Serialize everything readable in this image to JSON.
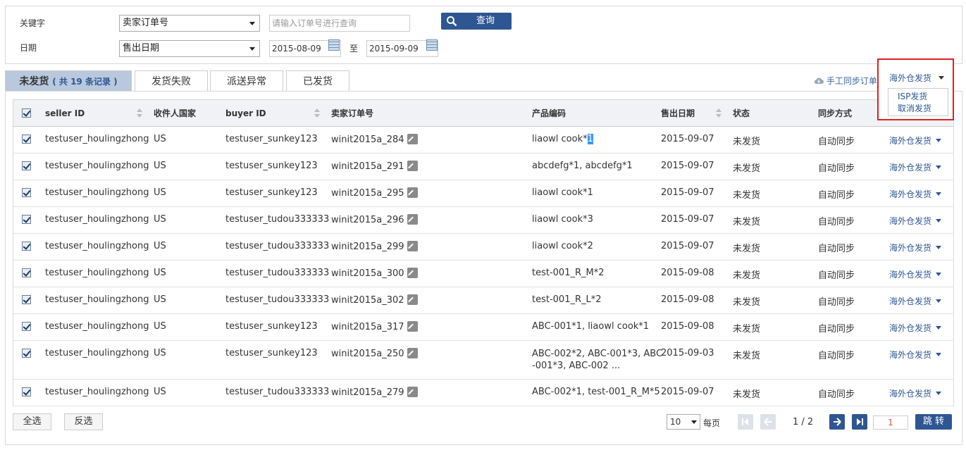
{
  "search": {
    "keyword_label": "关键字",
    "keyword_select": "卖家订单号",
    "keyword_placeholder": "请输入订单号进行查询",
    "date_label": "日期",
    "date_select": "售出日期",
    "date_from": "2015-08-09",
    "date_to_label": "至",
    "date_to": "2015-09-09",
    "search_button": "查询"
  },
  "tabs": [
    {
      "label": "未发货",
      "count": "( 共 19 条记录 )",
      "active": true
    },
    {
      "label": "发货失败"
    },
    {
      "label": "派送异常"
    },
    {
      "label": "已发货"
    }
  ],
  "toolbar": {
    "sync_label": "手工同步订单",
    "ship_dropdown": "海外仓发货",
    "ship_menu": [
      "ISP发货",
      "取消发货"
    ]
  },
  "table": {
    "headers": [
      "seller ID",
      "收件人国家",
      "buyer ID",
      "卖家订单号",
      "产品编码",
      "售出日期",
      "状态",
      "同步方式"
    ],
    "rows": [
      {
        "seller": "testuser_houlingzhong",
        "country": "US",
        "buyer": "testuser_sunkey123",
        "order": "winit2015a_284",
        "product": "liaowl cook*",
        "product_sel": "1",
        "date": "2015-09-07",
        "status": "未发货",
        "sync": "自动同步",
        "action": "海外仓发货"
      },
      {
        "seller": "testuser_houlingzhong",
        "country": "US",
        "buyer": "testuser_sunkey123",
        "order": "winit2015a_291",
        "product": "abcdefg*1, abcdefg*1",
        "date": "2015-09-07",
        "status": "未发货",
        "sync": "自动同步",
        "action": "海外仓发货"
      },
      {
        "seller": "testuser_houlingzhong",
        "country": "US",
        "buyer": "testuser_sunkey123",
        "order": "winit2015a_295",
        "product": "liaowl cook*1",
        "date": "2015-09-07",
        "status": "未发货",
        "sync": "自动同步",
        "action": "海外仓发货"
      },
      {
        "seller": "testuser_houlingzhong",
        "country": "US",
        "buyer": "testuser_tudou333333",
        "order": "winit2015a_296",
        "product": "liaowl cook*3",
        "date": "2015-09-07",
        "status": "未发货",
        "sync": "自动同步",
        "action": "海外仓发货"
      },
      {
        "seller": "testuser_houlingzhong",
        "country": "US",
        "buyer": "testuser_tudou333333",
        "order": "winit2015a_299",
        "product": "liaowl cook*2",
        "date": "2015-09-07",
        "status": "未发货",
        "sync": "自动同步",
        "action": "海外仓发货"
      },
      {
        "seller": "testuser_houlingzhong",
        "country": "US",
        "buyer": "testuser_tudou333333",
        "order": "winit2015a_300",
        "product": "test-001_R_M*2",
        "date": "2015-09-08",
        "status": "未发货",
        "sync": "自动同步",
        "action": "海外仓发货"
      },
      {
        "seller": "testuser_houlingzhong",
        "country": "US",
        "buyer": "testuser_tudou333333",
        "order": "winit2015a_302",
        "product": "test-001_R_L*2",
        "date": "2015-09-08",
        "status": "未发货",
        "sync": "自动同步",
        "action": "海外仓发货"
      },
      {
        "seller": "testuser_houlingzhong",
        "country": "US",
        "buyer": "testuser_sunkey123",
        "order": "winit2015a_317",
        "product": "ABC-001*1, liaowl cook*1",
        "date": "2015-09-08",
        "status": "未发货",
        "sync": "自动同步",
        "action": "海外仓发货"
      },
      {
        "seller": "testuser_houlingzhong",
        "country": "US",
        "buyer": "testuser_sunkey123",
        "order": "winit2015a_250",
        "product": "ABC-002*2, ABC-001*3, ABC",
        "product2": "-001*3, ABC-002 ...",
        "date": "2015-09-03",
        "status": "未发货",
        "sync": "自动同步",
        "action": "海外仓发货"
      },
      {
        "seller": "testuser_houlingzhong",
        "country": "US",
        "buyer": "testuser_tudou333333",
        "order": "winit2015a_279",
        "product": "ABC-002*1, test-001_R_M*5",
        "date": "2015-09-07",
        "status": "未发货",
        "sync": "自动同步",
        "action": "海外仓发货"
      }
    ]
  },
  "footer": {
    "select_all": "全选",
    "invert": "反选",
    "page_size": "10",
    "per_page": "每页",
    "page_info": "1 / 2",
    "jump_value": "1",
    "jump_button": "跳 转"
  }
}
